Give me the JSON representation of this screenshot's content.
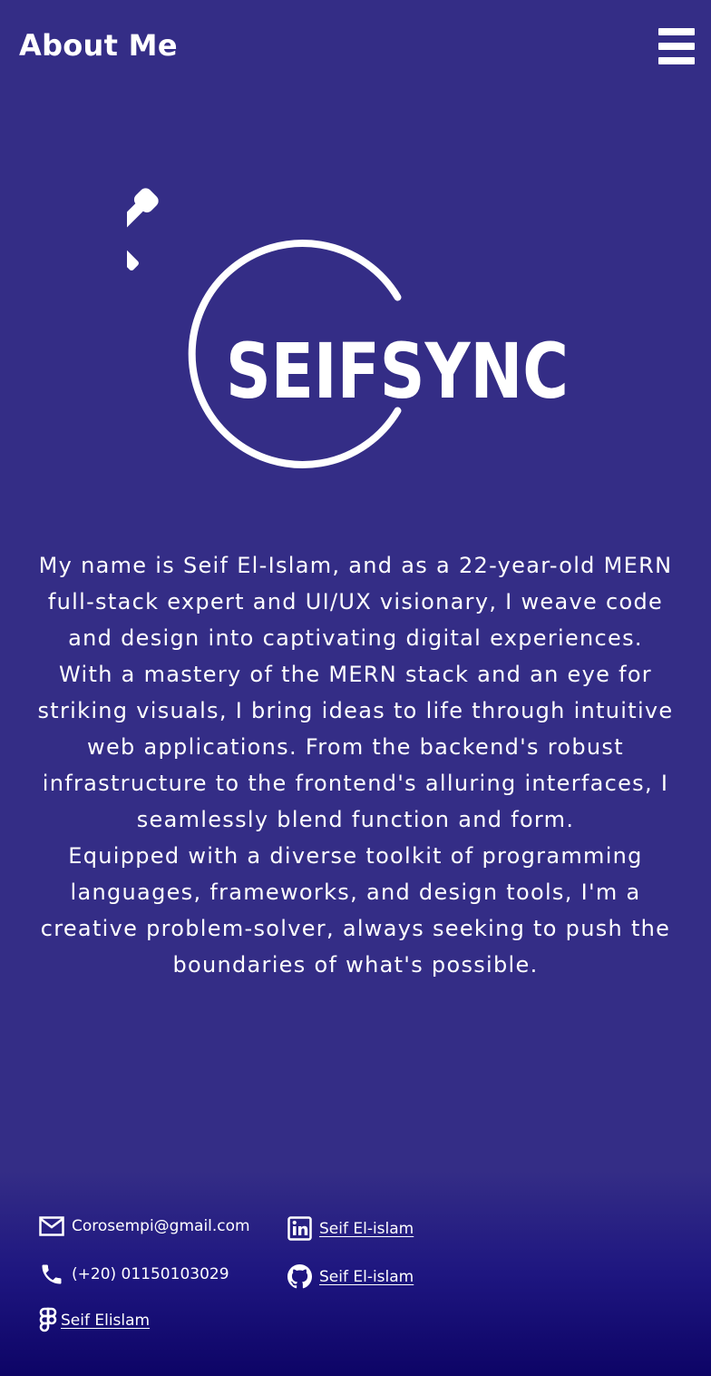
{
  "header": {
    "title": "About Me",
    "menu_icon": "hamburger-menu-icon"
  },
  "logo": {
    "text": "SEIFSYNC",
    "icon": "sword-circle-logo"
  },
  "bio": {
    "paragraphs": [
      "My name is Seif El-Islam, and as a 22-year-old MERN full-stack expert and UI/UX visionary, I weave code and design into captivating digital experiences.",
      "With a mastery of the MERN stack and an eye for striking visuals, I bring ideas to life through intuitive web applications. From the backend's robust infrastructure to the frontend's alluring interfaces, I seamlessly blend function and form.",
      "Equipped with a diverse toolkit of programming languages, frameworks, and design tools, I'm a creative problem-solver, always seeking to push the boundaries of what's possible."
    ]
  },
  "footer": {
    "email": {
      "icon": "mail-icon",
      "text": "Corosempi@gmail.com"
    },
    "phone": {
      "icon": "phone-icon",
      "text": "(+20) 01150103029"
    },
    "figma": {
      "icon": "figma-icon",
      "text": "Seif Elislam"
    },
    "linkedin": {
      "icon": "linkedin-icon",
      "text": "Seif El-islam"
    },
    "github": {
      "icon": "github-icon",
      "text": "Seif El-islam"
    }
  },
  "colors": {
    "background": "#342d86",
    "footer_bottom": "#0d0466",
    "text": "#ffffff"
  }
}
